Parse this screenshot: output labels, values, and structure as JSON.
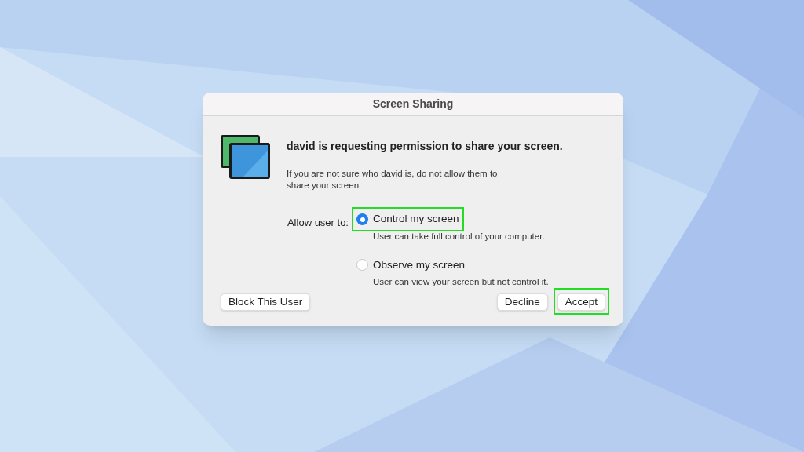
{
  "window": {
    "title": "Screen Sharing"
  },
  "heading": "david is requesting permission to share your screen.",
  "message": "If you are not sure who david is, do not allow them to share your screen.",
  "allow_label": "Allow user to:",
  "options": [
    {
      "label": "Control my screen",
      "description": "User can take full control of your computer.",
      "selected": true,
      "highlighted": true
    },
    {
      "label": "Observe my screen",
      "description": "User can view your screen but not control it.",
      "selected": false,
      "highlighted": false
    }
  ],
  "buttons": [
    {
      "label": "Block This User",
      "kind": "left",
      "highlighted": false
    },
    {
      "label": "Decline",
      "kind": "right",
      "highlighted": false
    },
    {
      "label": "Accept",
      "kind": "right",
      "highlighted": true
    }
  ]
}
